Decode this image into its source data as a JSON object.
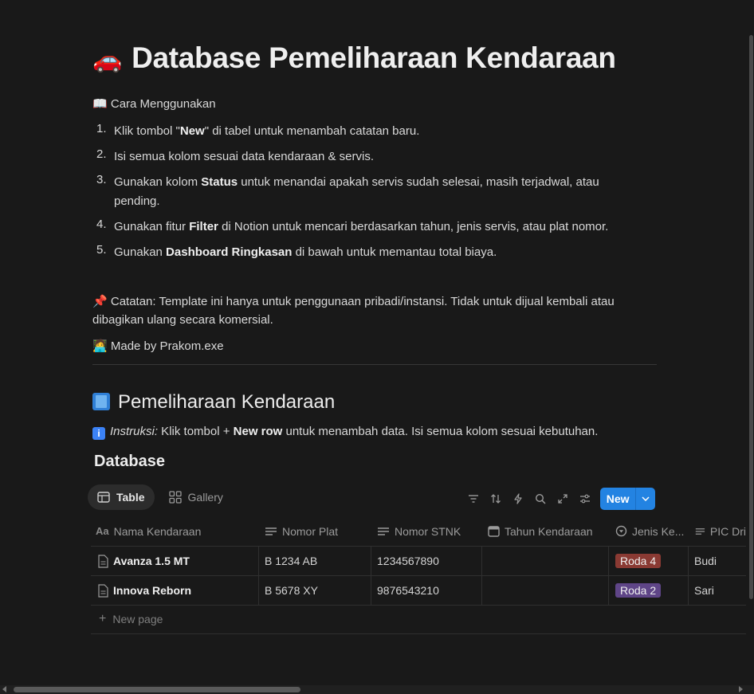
{
  "header": {
    "icon": "car-emoji",
    "title": "Database Pemeliharaan Kendaraan"
  },
  "guide": {
    "heading": "Cara Menggunakan",
    "steps": [
      {
        "n": "1.",
        "pre": "Klik tombol \"",
        "bold": "New",
        "post": "\" di tabel untuk menambah catatan baru."
      },
      {
        "n": "2.",
        "pre": "Isi semua kolom sesuai data kendaraan & servis.",
        "bold": "",
        "post": ""
      },
      {
        "n": "3.",
        "pre": "Gunakan kolom ",
        "bold": "Status",
        "post": " untuk menandai apakah servis sudah selesai, masih terjadwal, atau pending."
      },
      {
        "n": "4.",
        "pre": "Gunakan fitur ",
        "bold": "Filter",
        "post": " di Notion untuk mencari berdasarkan tahun, jenis servis, atau plat nomor."
      },
      {
        "n": "5.",
        "pre": "Gunakan ",
        "bold": "Dashboard Ringkasan",
        "post": " di bawah untuk memantau total biaya."
      }
    ],
    "note_line1": "Catatan: Template ini hanya untuk penggunaan pribadi/instansi. Tidak untuk dijual kembali atau",
    "note_line2": "dibagikan ulang secara komersial.",
    "made_by": "Made by Prakom.exe"
  },
  "section": {
    "title": "Pemeliharaan Kendaraan",
    "instr_label": "Instruksi:",
    "instr_pre": " Klik tombol + ",
    "instr_bold": "New row",
    "instr_post": " untuk menambah data. Isi semua kolom sesuai kebutuhan."
  },
  "database": {
    "title": "Database",
    "tabs": [
      "Table",
      "Gallery"
    ],
    "new_label": "New",
    "columns": [
      "Nama Kendaraan",
      "Nomor Plat",
      "Nomor STNK",
      "Tahun Kendaraan",
      "Jenis Ke...",
      "PIC Dri"
    ],
    "rows": [
      {
        "nama": "Avanza 1.5 MT",
        "plat": "B 1234 AB",
        "stnk": "1234567890",
        "tahun": "",
        "jenis": "Roda 4",
        "jenis_color": "#8a3a33",
        "pic": "Budi"
      },
      {
        "nama": "Innova Reborn",
        "plat": "B 5678 XY",
        "stnk": "9876543210",
        "tahun": "",
        "jenis": "Roda 2",
        "jenis_color": "#5f4587",
        "pic": "Sari"
      }
    ],
    "new_page": "New page"
  }
}
